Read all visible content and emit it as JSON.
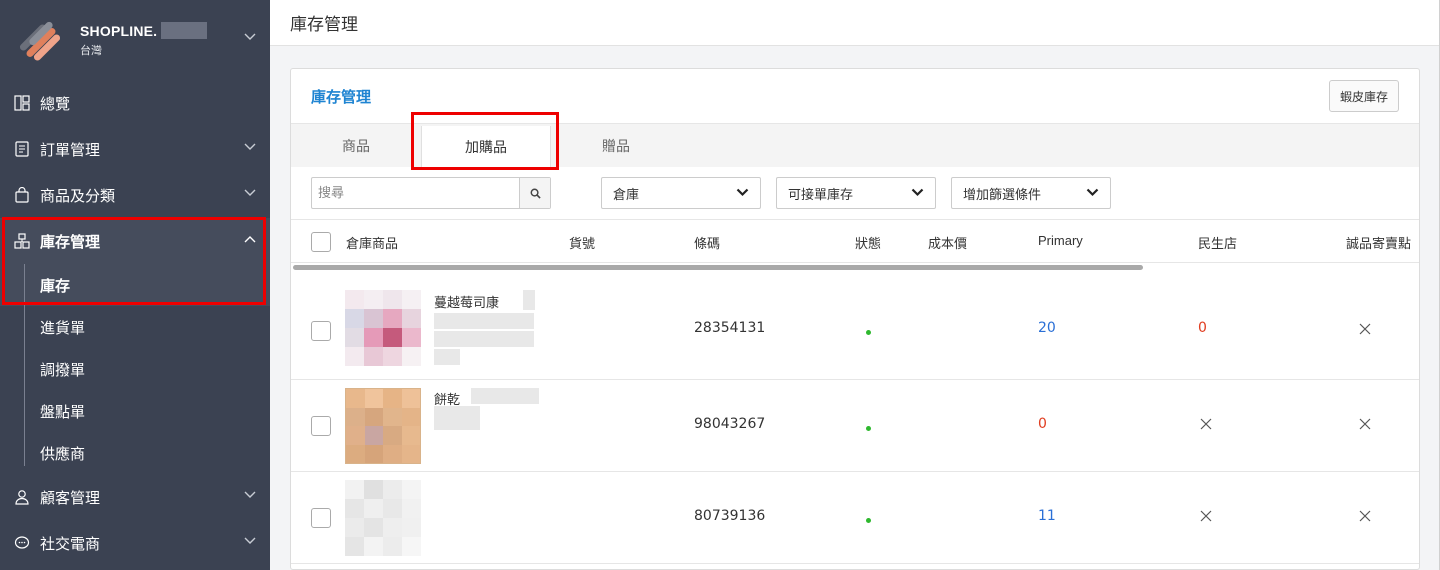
{
  "sidebar": {
    "brand_name": "SHOPLINE.",
    "brand_region": "台灣",
    "items": [
      {
        "label": "總覽",
        "icon": "dashboard-icon"
      },
      {
        "label": "訂單管理",
        "icon": "order-icon"
      },
      {
        "label": "商品及分類",
        "icon": "bag-icon"
      },
      {
        "label": "庫存管理",
        "icon": "inventory-icon"
      },
      {
        "label": "顧客管理",
        "icon": "user-icon"
      },
      {
        "label": "社交電商",
        "icon": "chat-icon"
      }
    ],
    "inventory_sub": [
      "庫存",
      "進貨單",
      "調撥單",
      "盤點單",
      "供應商"
    ]
  },
  "header": {
    "title": "庫存管理"
  },
  "card": {
    "title": "庫存管理",
    "shopee_button": "蝦皮庫存",
    "tabs": [
      "商品",
      "加購品",
      "贈品"
    ],
    "active_tab": "加購品"
  },
  "filters": {
    "search_placeholder": "搜尋",
    "warehouse": "倉庫",
    "orderable_stock": "可接單庫存",
    "add_filter": "增加篩選條件"
  },
  "table": {
    "columns": [
      "倉庫商品",
      "貨號",
      "條碼",
      "狀態",
      "成本價",
      "Primary",
      "民生店",
      "誠品寄賣點"
    ],
    "rows": [
      {
        "name": "蔓越莓司康",
        "barcode": "28354131",
        "primary": "20",
        "minsheng": "0",
        "eslite": "×"
      },
      {
        "name": "餅乾",
        "barcode": "98043267",
        "primary": "0",
        "minsheng": "×",
        "eslite": "×"
      },
      {
        "name": "",
        "barcode": "80739136",
        "primary": "11",
        "minsheng": "×",
        "eslite": "×"
      }
    ]
  },
  "colors": {
    "sidebar_bg": "#3b4252",
    "accent": "#1f84d2",
    "highlight": "#ee0000",
    "status_green": "#2eb82e",
    "positive_blue": "#2a6fd6",
    "zero_red": "#e03c1f"
  }
}
